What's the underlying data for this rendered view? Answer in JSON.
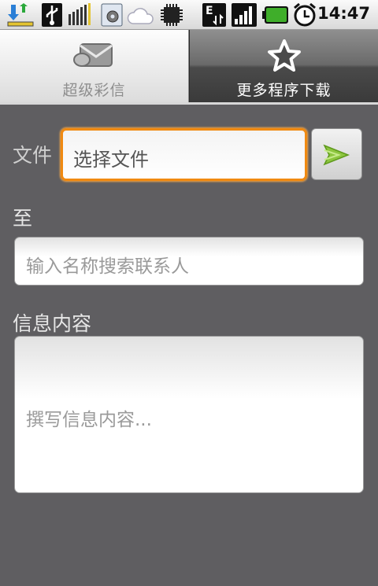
{
  "status_bar": {
    "time": "14:47",
    "icons": [
      "download-icon",
      "usb-icon",
      "signal-strength-icon",
      "settings-icon",
      "cloud-icon",
      "chip-icon",
      "edge-data-icon",
      "cell-signal-icon",
      "battery-icon",
      "alarm-icon"
    ],
    "network_type": "E"
  },
  "tabs": [
    {
      "label": "超级彩信",
      "icon": "mms-envelope-icon",
      "selected": false
    },
    {
      "label": "更多程序下载",
      "icon": "star-icon",
      "selected": true
    }
  ],
  "form": {
    "file_label": "文件",
    "file_placeholder": "选择文件",
    "send_icon": "send-arrow-icon",
    "to_label": "至",
    "to_placeholder": "输入名称搜索联系人",
    "content_label": "信息内容",
    "content_placeholder": "撰写信息内容..."
  },
  "colors": {
    "background": "#5f5e61",
    "focus_border": "#f08a12",
    "send_arrow": "#8dc63f"
  }
}
